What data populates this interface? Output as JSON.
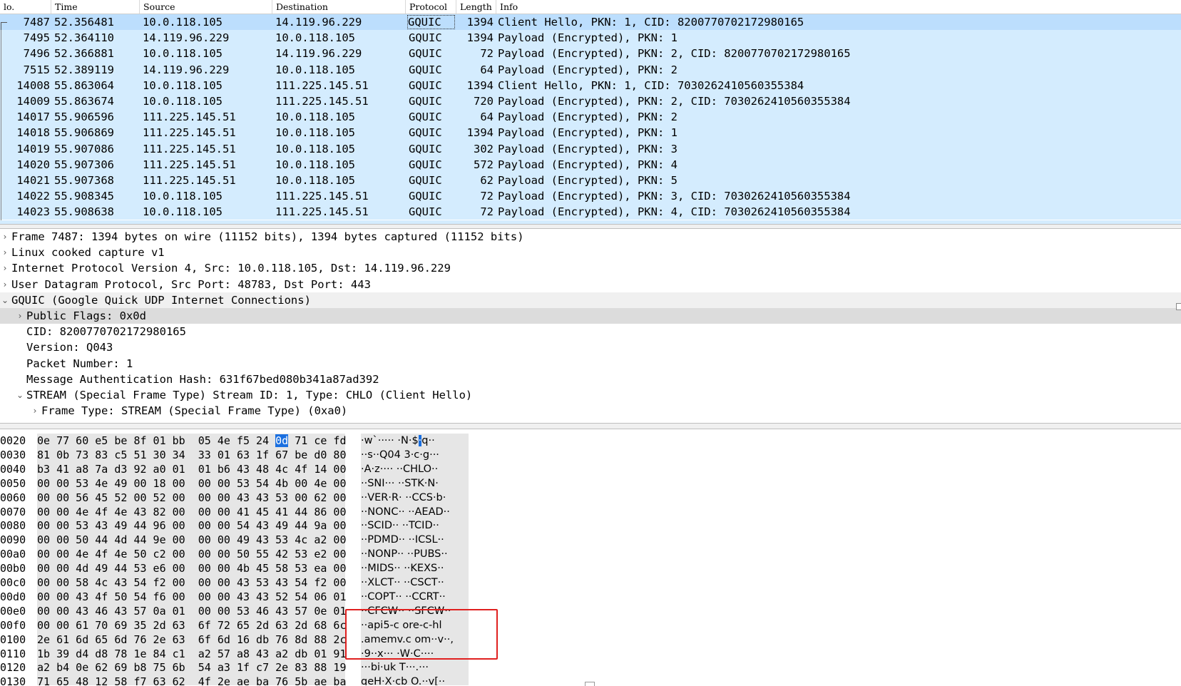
{
  "columns": {
    "no": "lo.",
    "time": "Time",
    "source": "Source",
    "destination": "Destination",
    "protocol": "Protocol",
    "length": "Length",
    "info": "Info"
  },
  "packets": [
    {
      "no": "7487",
      "time": "52.356481",
      "source": "10.0.118.105",
      "destination": "14.119.96.229",
      "protocol": "GQUIC",
      "length": "1394",
      "info": "Client Hello, PKN: 1, CID: 8200770702172980165",
      "selected": true
    },
    {
      "no": "7495",
      "time": "52.364110",
      "source": "14.119.96.229",
      "destination": "10.0.118.105",
      "protocol": "GQUIC",
      "length": "1394",
      "info": "Payload (Encrypted), PKN: 1"
    },
    {
      "no": "7496",
      "time": "52.366881",
      "source": "10.0.118.105",
      "destination": "14.119.96.229",
      "protocol": "GQUIC",
      "length": "72",
      "info": "Payload (Encrypted), PKN: 2, CID: 8200770702172980165"
    },
    {
      "no": "7515",
      "time": "52.389119",
      "source": "14.119.96.229",
      "destination": "10.0.118.105",
      "protocol": "GQUIC",
      "length": "64",
      "info": "Payload (Encrypted), PKN: 2"
    },
    {
      "no": "14008",
      "time": "55.863064",
      "source": "10.0.118.105",
      "destination": "111.225.145.51",
      "protocol": "GQUIC",
      "length": "1394",
      "info": "Client Hello, PKN: 1, CID: 7030262410560355384"
    },
    {
      "no": "14009",
      "time": "55.863674",
      "source": "10.0.118.105",
      "destination": "111.225.145.51",
      "protocol": "GQUIC",
      "length": "720",
      "info": "Payload (Encrypted), PKN: 2, CID: 7030262410560355384"
    },
    {
      "no": "14017",
      "time": "55.906596",
      "source": "111.225.145.51",
      "destination": "10.0.118.105",
      "protocol": "GQUIC",
      "length": "64",
      "info": "Payload (Encrypted), PKN: 2"
    },
    {
      "no": "14018",
      "time": "55.906869",
      "source": "111.225.145.51",
      "destination": "10.0.118.105",
      "protocol": "GQUIC",
      "length": "1394",
      "info": "Payload (Encrypted), PKN: 1"
    },
    {
      "no": "14019",
      "time": "55.907086",
      "source": "111.225.145.51",
      "destination": "10.0.118.105",
      "protocol": "GQUIC",
      "length": "302",
      "info": "Payload (Encrypted), PKN: 3"
    },
    {
      "no": "14020",
      "time": "55.907306",
      "source": "111.225.145.51",
      "destination": "10.0.118.105",
      "protocol": "GQUIC",
      "length": "572",
      "info": "Payload (Encrypted), PKN: 4"
    },
    {
      "no": "14021",
      "time": "55.907368",
      "source": "111.225.145.51",
      "destination": "10.0.118.105",
      "protocol": "GQUIC",
      "length": "62",
      "info": "Payload (Encrypted), PKN: 5"
    },
    {
      "no": "14022",
      "time": "55.908345",
      "source": "10.0.118.105",
      "destination": "111.225.145.51",
      "protocol": "GQUIC",
      "length": "72",
      "info": "Payload (Encrypted), PKN: 3, CID: 7030262410560355384"
    },
    {
      "no": "14023",
      "time": "55.908638",
      "source": "10.0.118.105",
      "destination": "111.225.145.51",
      "protocol": "GQUIC",
      "length": "72",
      "info": "Payload (Encrypted), PKN: 4, CID: 7030262410560355384"
    }
  ],
  "details": [
    {
      "indent": 0,
      "arrow": "›",
      "text": "Frame 7487: 1394 bytes on wire (11152 bits), 1394 bytes captured (11152 bits)"
    },
    {
      "indent": 0,
      "arrow": "›",
      "text": "Linux cooked capture v1"
    },
    {
      "indent": 0,
      "arrow": "›",
      "text": "Internet Protocol Version 4, Src: 10.0.118.105, Dst: 14.119.96.229"
    },
    {
      "indent": 0,
      "arrow": "›",
      "text": "User Datagram Protocol, Src Port: 48783, Dst Port: 443"
    },
    {
      "indent": 0,
      "arrow": "⌄",
      "text": "GQUIC (Google Quick UDP Internet Connections)",
      "state": "group"
    },
    {
      "indent": 1,
      "arrow": "›",
      "text": "Public Flags: 0x0d",
      "state": "item"
    },
    {
      "indent": 1,
      "arrow": "",
      "text": "CID: 8200770702172980165"
    },
    {
      "indent": 1,
      "arrow": "",
      "text": "Version: Q043"
    },
    {
      "indent": 1,
      "arrow": "",
      "text": "Packet Number: 1"
    },
    {
      "indent": 1,
      "arrow": "",
      "text": "Message Authentication Hash: 631f67bed080b341a87ad392"
    },
    {
      "indent": 1,
      "arrow": "⌄",
      "text": "STREAM (Special Frame Type) Stream ID: 1, Type: CHLO (Client Hello)"
    },
    {
      "indent": 2,
      "arrow": "›",
      "text": "Frame Type: STREAM (Special Frame Type) (0xa0)"
    }
  ],
  "hex_rows": [
    {
      "offset": "0020",
      "b1": "0e 77 60 e5 be 8f 01 bb",
      "b2a": "05 4e f5 24 ",
      "b2h": "0d",
      "b2b": " 71 ce fd",
      "a1": "·w`·····",
      "a2a": "·N·$",
      "a2h": "·",
      "a2b": "q··"
    },
    {
      "offset": "0030",
      "b1": "81 0b 73 83 c5 51 30 34",
      "b2": "33 01 63 1f 67 be d0 80",
      "a1": "··s··Q04",
      "a2": "3·c·g···"
    },
    {
      "offset": "0040",
      "b1": "b3 41 a8 7a d3 92 a0 01",
      "b2": "01 b6 43 48 4c 4f 14 00",
      "a1": "·A·z····",
      "a2": "··CHLO··"
    },
    {
      "offset": "0050",
      "b1": "00 00 53 4e 49 00 18 00",
      "b2": "00 00 53 54 4b 00 4e 00",
      "a1": "··SNI···",
      "a2": "··STK·N·"
    },
    {
      "offset": "0060",
      "b1": "00 00 56 45 52 00 52 00",
      "b2": "00 00 43 43 53 00 62 00",
      "a1": "··VER·R·",
      "a2": "··CCS·b·"
    },
    {
      "offset": "0070",
      "b1": "00 00 4e 4f 4e 43 82 00",
      "b2": "00 00 41 45 41 44 86 00",
      "a1": "··NONC··",
      "a2": "··AEAD··"
    },
    {
      "offset": "0080",
      "b1": "00 00 53 43 49 44 96 00",
      "b2": "00 00 54 43 49 44 9a 00",
      "a1": "··SCID··",
      "a2": "··TCID··"
    },
    {
      "offset": "0090",
      "b1": "00 00 50 44 4d 44 9e 00",
      "b2": "00 00 49 43 53 4c a2 00",
      "a1": "··PDMD··",
      "a2": "··ICSL··"
    },
    {
      "offset": "00a0",
      "b1": "00 00 4e 4f 4e 50 c2 00",
      "b2": "00 00 50 55 42 53 e2 00",
      "a1": "··NONP··",
      "a2": "··PUBS··"
    },
    {
      "offset": "00b0",
      "b1": "00 00 4d 49 44 53 e6 00",
      "b2": "00 00 4b 45 58 53 ea 00",
      "a1": "··MIDS··",
      "a2": "··KEXS··"
    },
    {
      "offset": "00c0",
      "b1": "00 00 58 4c 43 54 f2 00",
      "b2": "00 00 43 53 43 54 f2 00",
      "a1": "··XLCT··",
      "a2": "··CSCT··"
    },
    {
      "offset": "00d0",
      "b1": "00 00 43 4f 50 54 f6 00",
      "b2": "00 00 43 43 52 54 06 01",
      "a1": "··COPT··",
      "a2": "··CCRT··"
    },
    {
      "offset": "00e0",
      "b1": "00 00 43 46 43 57 0a 01",
      "b2": "00 00 53 46 43 57 0e 01",
      "a1": "··CFCW··",
      "a2": "··SFCW··"
    },
    {
      "offset": "00f0",
      "b1": "00 00 61 70 69 35 2d 63",
      "b2": "6f 72 65 2d 63 2d 68 6c",
      "a1": "··api5-c",
      "a2": "ore-c-hl"
    },
    {
      "offset": "0100",
      "b1": "2e 61 6d 65 6d 76 2e 63",
      "b2": "6f 6d 16 db 76 8d 88 2c",
      "a1": ".amemv.c",
      "a2": "om··v··,"
    },
    {
      "offset": "0110",
      "b1": "1b 39 d4 d8 78 1e 84 c1",
      "b2": "a2 57 a8 43 a2 db 01 91",
      "a1": "·9··x···",
      "a2": "·W·C····"
    },
    {
      "offset": "0120",
      "b1": "a2 b4 0e 62 69 b8 75 6b",
      "b2": "54 a3 1f c7 2e 83 88 19",
      "a1": "···bi·uk",
      "a2": "T···.···"
    },
    {
      "offset": "0130",
      "b1": "71 65 48 12 58 f7 63 62",
      "b2": "4f 2e ae ba 76 5b ae ba",
      "a1": "qeH·X·cb",
      "a2": "O.··v[··"
    }
  ],
  "colors": {
    "row_bg": "#d4ecfe",
    "selected_row_bg": "#bcdefd",
    "highlight_byte": "#1a6fe0",
    "annotation": "#e0201f"
  }
}
